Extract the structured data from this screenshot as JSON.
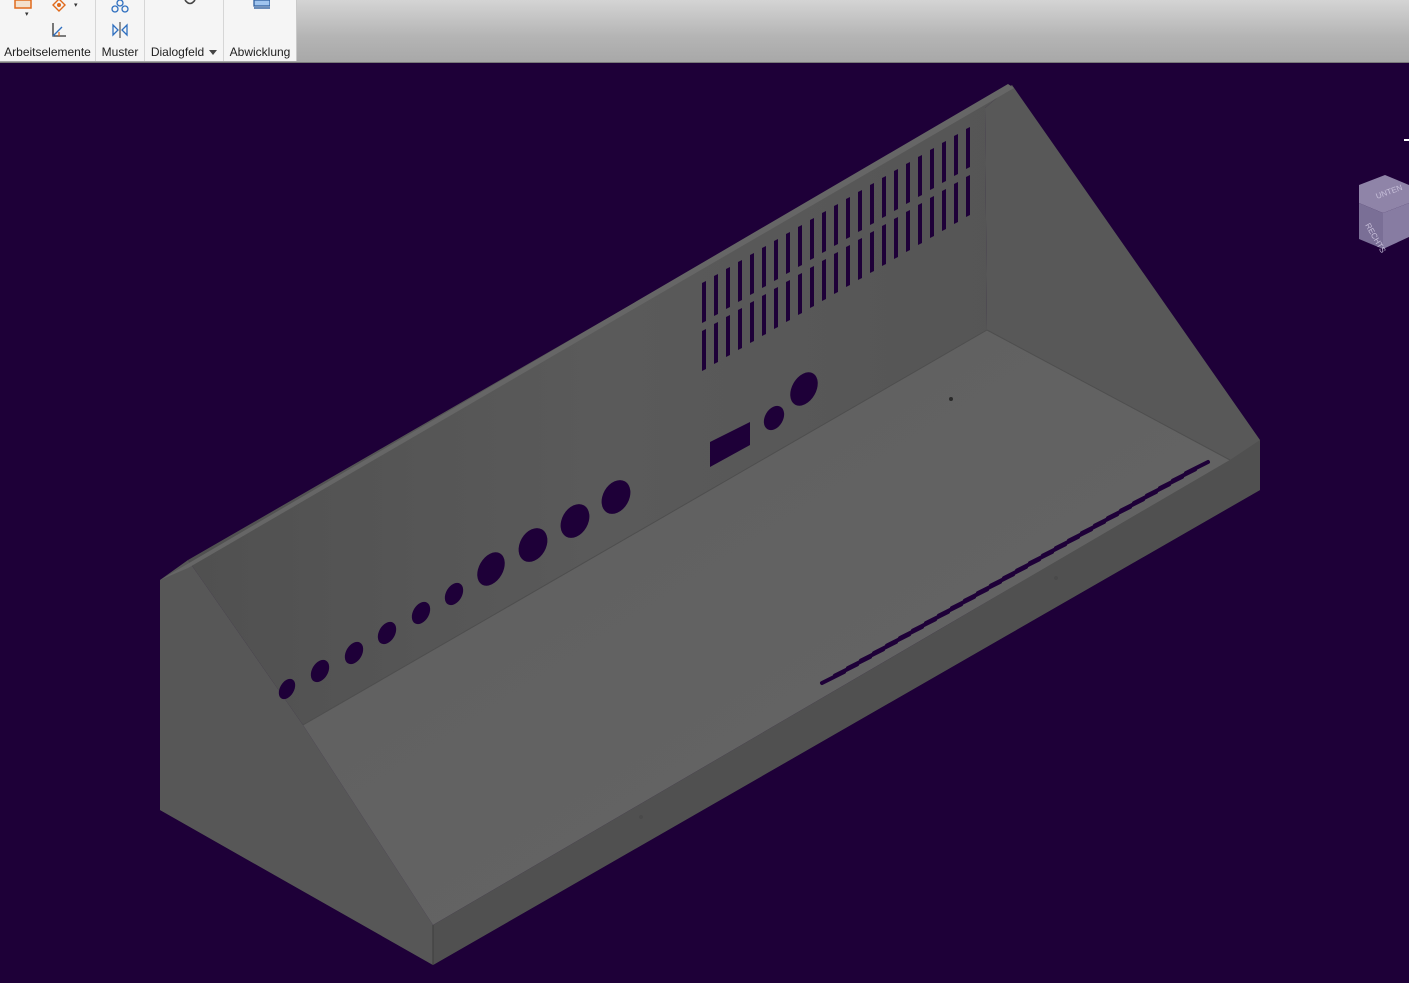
{
  "ribbon": {
    "panels": [
      {
        "label": "Arbeitselemente"
      },
      {
        "label": "Muster"
      },
      {
        "label": "Dialogfeld"
      },
      {
        "label": "Abwicklung"
      }
    ],
    "icons": [
      "sketch-icon",
      "work-point-icon",
      "ucs-icon",
      "rectangular-pattern-icon",
      "mirror-icon",
      "flat-pattern-icon"
    ]
  },
  "viewport": {
    "background_color": "#1e0038",
    "model": "sheet-metal-enclosure",
    "model_color": "#5a5a5a"
  },
  "viewcube": {
    "faces": [
      "UNTEN",
      "RECHTS"
    ]
  }
}
